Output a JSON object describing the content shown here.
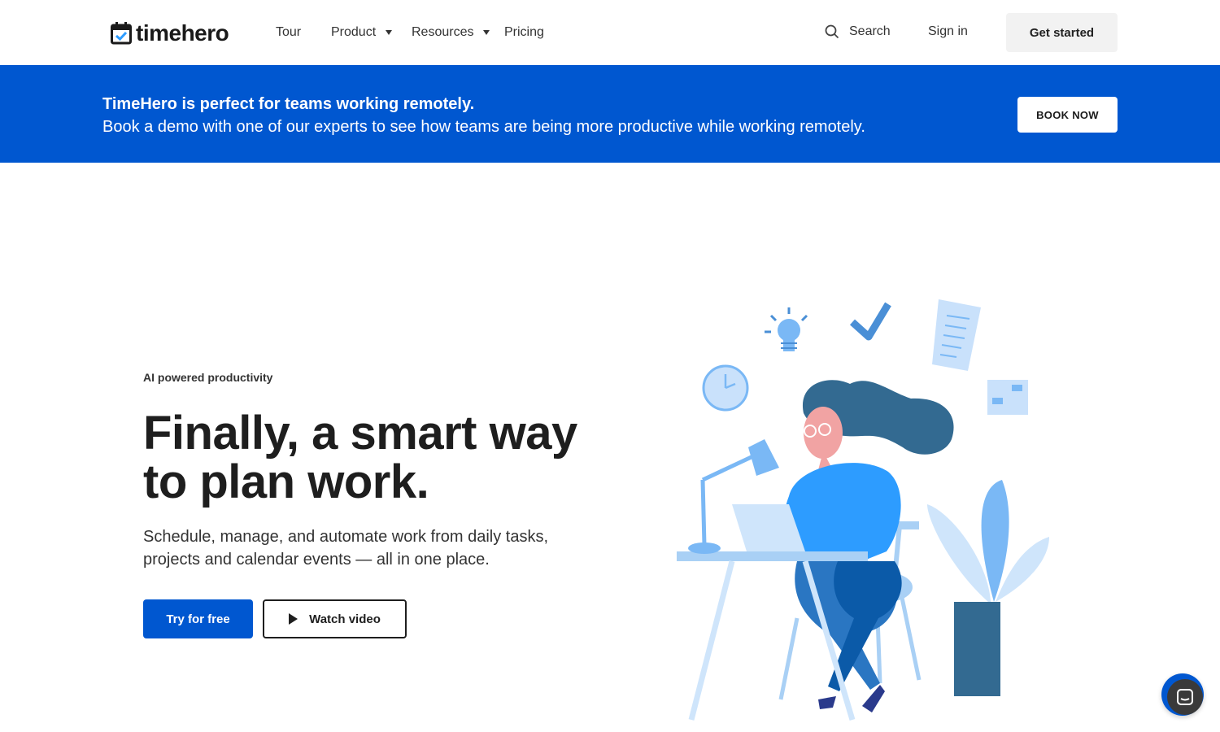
{
  "nav": {
    "logo_text": "timehero",
    "links": [
      {
        "label": "Tour",
        "has_dropdown": false
      },
      {
        "label": "Product",
        "has_dropdown": true
      },
      {
        "label": "Resources",
        "has_dropdown": true
      },
      {
        "label": "Pricing",
        "has_dropdown": false
      }
    ],
    "search_label": "Search",
    "signin_label": "Sign in",
    "cta_label": "Get started"
  },
  "banner": {
    "title": "TimeHero is perfect for teams working remotely.",
    "subtitle": "Book a demo with one of our experts to see how teams are being more productive while working remotely.",
    "button_label": "BOOK NOW",
    "background": "#0057d0"
  },
  "hero": {
    "eyebrow": "AI powered productivity",
    "headline": "Finally, a smart way to plan work.",
    "subtext": "Schedule, manage, and automate work from daily tasks, projects and calendar events — all in one place.",
    "primary_button": "Try for free",
    "secondary_button": "Watch video"
  },
  "colors": {
    "accent": "#0057d0",
    "illustration_dark": "#336a91",
    "illustration_mid": "#2d9cff",
    "illustration_light": "#cfe5fb"
  },
  "icons": [
    "calendar-check-icon",
    "search-icon",
    "caret-down-icon",
    "play-icon",
    "chat-icon"
  ]
}
